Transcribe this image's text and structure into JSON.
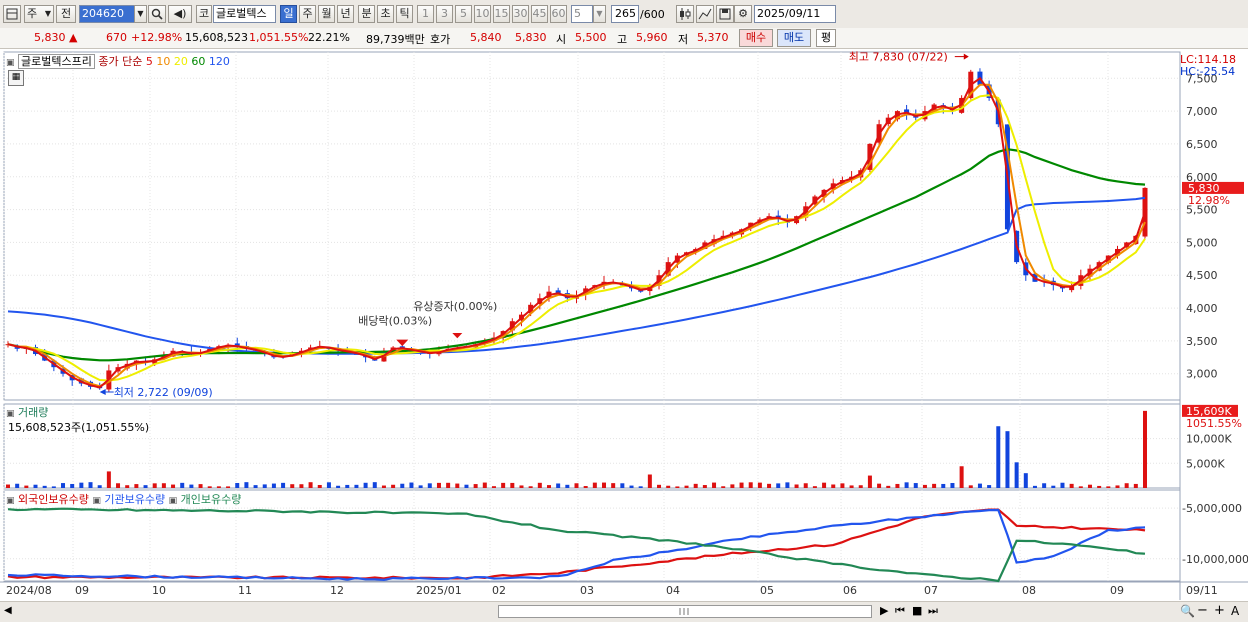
{
  "toolbar": {
    "period_selector": "주",
    "prev_label": "전",
    "stock_code": "204620",
    "stock_name": "글로벌텍스",
    "market_btn": "코",
    "period_tabs": [
      "일",
      "주",
      "월",
      "년",
      "분",
      "초",
      "틱"
    ],
    "intervals": [
      "1",
      "3",
      "5",
      "10",
      "15",
      "30",
      "45",
      "60"
    ],
    "interval_value": "5",
    "count_value": "265",
    "count_max": "/600",
    "date_value": "2025/09/11"
  },
  "quote": {
    "price": "5,830",
    "change_arrow": "▲",
    "change": "670",
    "change_rate": "+12.98%",
    "volume": "15,608,523",
    "volume_rate": "1,051.55%",
    "turnover_pct": "22.21%",
    "amount": "89,739백만",
    "bid_label": "호가",
    "ask_price": "5,840",
    "bid_price": "5,830",
    "open_label": "시",
    "open": "5,500",
    "high_label": "고",
    "high": "5,960",
    "low_label": "저",
    "low": "5,370",
    "buy_label": "매수",
    "sell_label": "매도",
    "eval_label": "평"
  },
  "price_panel": {
    "name_label": "글로벌텍스프리",
    "ma_title": "종가 단순",
    "ma_periods": [
      "5",
      "10",
      "20",
      "60",
      "120"
    ],
    "ma_colors": [
      "#dd1111",
      "#f08a00",
      "#eeee00",
      "#008800",
      "#2255ee"
    ],
    "lc_label": "LC:114.18",
    "hc_label": "HC:-25.54",
    "current_price_tag": "5,830",
    "current_pct_tag": "12.98%",
    "high_annotation": "최고 7,830 (07/22)",
    "low_annotation": "최저 2,722 (09/09)",
    "event_label_1": "유상증자(0.00%)",
    "event_label_2": "배당락(0.03%)",
    "y_ticks": [
      "7,500",
      "7,000",
      "6,500",
      "6,000",
      "5,500",
      "5,000",
      "4,500",
      "4,000",
      "3,500",
      "3,000"
    ]
  },
  "volume_panel": {
    "title": "거래량",
    "summary": "15,608,523주(1,051.55%)",
    "tag_value": "15,609K",
    "tag_pct": "1051.55%",
    "y_ticks": [
      "10,000K",
      "5,000K"
    ]
  },
  "holdings_panel": {
    "legend": [
      "외국인보유수량",
      "기관보유수량",
      "개인보유수량"
    ],
    "legend_colors": [
      "#dd1111",
      "#2255ee",
      "#228855"
    ],
    "y_ticks": [
      "-5,000,000",
      "-10,000,000"
    ]
  },
  "x_axis": {
    "labels": [
      "2024/08",
      "09",
      "10",
      "11",
      "12",
      "2025/01",
      "02",
      "03",
      "04",
      "05",
      "06",
      "07",
      "08",
      "09"
    ],
    "end_label": "09/11"
  },
  "chart_data": {
    "type": "candlestick",
    "y_range": [
      2600,
      7900
    ],
    "current_price": 5830,
    "high": {
      "value": 7830,
      "date": "07/22"
    },
    "low": {
      "value": 2722,
      "date": "09/09"
    },
    "close_series": [
      3450,
      3380,
      3400,
      3300,
      3200,
      3100,
      3000,
      2900,
      2850,
      2800,
      2780,
      3050,
      3100,
      3150,
      3200,
      3170,
      3220,
      3280,
      3350,
      3320,
      3300,
      3330,
      3380,
      3420,
      3440,
      3400,
      3380,
      3350,
      3300,
      3250,
      3260,
      3300,
      3350,
      3400,
      3420,
      3380,
      3350,
      3330,
      3300,
      3250,
      3200,
      3350,
      3400,
      3380,
      3350,
      3330,
      3300,
      3350,
      3380,
      3400,
      3420,
      3450,
      3500,
      3550,
      3650,
      3800,
      3900,
      4050,
      4150,
      4250,
      4200,
      4150,
      4200,
      4300,
      4350,
      4400,
      4380,
      4350,
      4300,
      4250,
      4350,
      4500,
      4700,
      4800,
      4850,
      4900,
      5000,
      5050,
      5100,
      5150,
      5200,
      5300,
      5350,
      5400,
      5350,
      5300,
      5400,
      5550,
      5700,
      5800,
      5900,
      5950,
      6000,
      6100,
      6500,
      6800,
      6900,
      7000,
      6950,
      6900,
      7000,
      7100,
      7050,
      7000,
      7200,
      7600,
      7400,
      7200,
      6800,
      5200,
      4700,
      4500,
      4400,
      4400,
      4350,
      4300,
      4350,
      4500,
      4600,
      4700,
      4800,
      4900,
      5000,
      5100,
      5830
    ],
    "ma60_series": [
      3450,
      3420,
      3390,
      3360,
      3320,
      3290,
      3260,
      3240,
      3225,
      3215,
      3205,
      3205,
      3210,
      3220,
      3235,
      3250,
      3265,
      3280,
      3290,
      3300,
      3305,
      3310,
      3312,
      3314,
      3316,
      3316,
      3316,
      3315,
      3314,
      3313,
      3312,
      3313,
      3315,
      3318,
      3321,
      3322,
      3324,
      3326,
      3328,
      3330,
      3332,
      3336,
      3340,
      3346,
      3353,
      3362,
      3374,
      3390,
      3408,
      3428,
      3450,
      3475,
      3502,
      3530,
      3560,
      3592,
      3624,
      3658,
      3694,
      3730,
      3768,
      3806,
      3844,
      3882,
      3920,
      3958,
      3996,
      4034,
      4074,
      4114,
      4156,
      4198,
      4240,
      4282,
      4324,
      4368,
      4412,
      4456,
      4500,
      4545,
      4592,
      4640,
      4690,
      4742,
      4796,
      4852,
      4910,
      4970,
      5030,
      5090,
      5150,
      5210,
      5270,
      5330,
      5390,
      5450,
      5510,
      5570,
      5630,
      5690,
      5760,
      5830,
      5900,
      5970,
      6040,
      6120,
      6220,
      6320,
      6380,
      6420,
      6400,
      6360,
      6300,
      6250,
      6200,
      6150,
      6100,
      6060,
      6020,
      5980,
      5950,
      5930,
      5910,
      5890,
      5880
    ],
    "ma120_series": [
      3950,
      3940,
      3930,
      3915,
      3900,
      3880,
      3860,
      3835,
      3810,
      3780,
      3745,
      3710,
      3675,
      3640,
      3605,
      3570,
      3540,
      3510,
      3480,
      3455,
      3430,
      3410,
      3392,
      3376,
      3362,
      3350,
      3340,
      3332,
      3325,
      3320,
      3316,
      3312,
      3310,
      3308,
      3306,
      3305,
      3304,
      3304,
      3304,
      3305,
      3306,
      3308,
      3310,
      3312,
      3315,
      3318,
      3322,
      3326,
      3330,
      3336,
      3342,
      3350,
      3360,
      3372,
      3385,
      3400,
      3416,
      3432,
      3450,
      3470,
      3490,
      3512,
      3534,
      3556,
      3580,
      3604,
      3628,
      3652,
      3676,
      3700,
      3725,
      3750,
      3776,
      3802,
      3828,
      3856,
      3884,
      3912,
      3940,
      3970,
      4000,
      4030,
      4062,
      4094,
      4126,
      4160,
      4194,
      4228,
      4262,
      4296,
      4330,
      4365,
      4400,
      4436,
      4472,
      4510,
      4550,
      4590,
      4630,
      4672,
      4716,
      4760,
      4806,
      4852,
      4900,
      4950,
      5000,
      5050,
      5100,
      5150,
      5500,
      5560,
      5580,
      5590,
      5600,
      5605,
      5610,
      5615,
      5620,
      5625,
      5630,
      5640,
      5650,
      5660,
      5680
    ]
  }
}
